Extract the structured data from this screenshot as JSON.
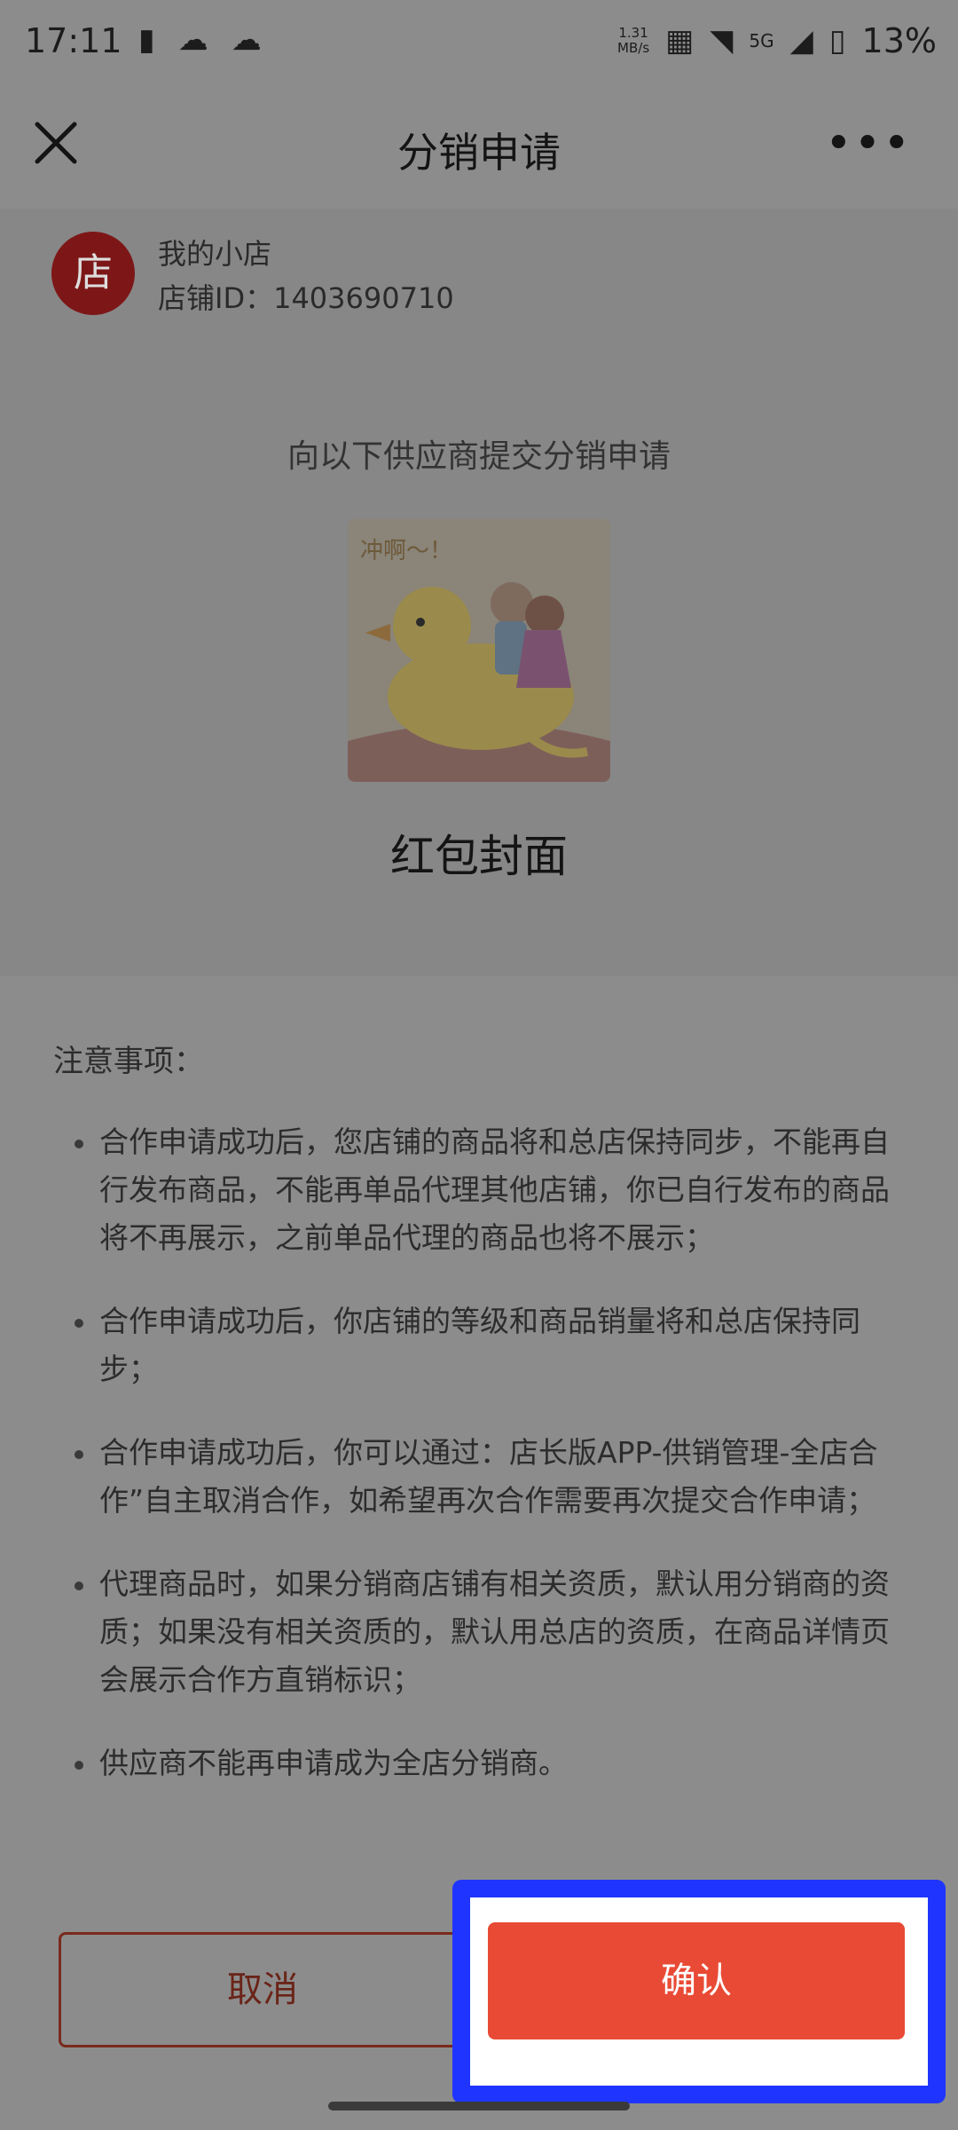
{
  "status_bar": {
    "time": "17:11",
    "net_speed_value": "1.31",
    "net_speed_unit": "MB/s",
    "signal_label": "5G",
    "battery": "13%"
  },
  "nav": {
    "title": "分销申请"
  },
  "shop": {
    "avatar_char": "店",
    "name": "我的小店",
    "id": "店铺ID：1403690710"
  },
  "supplier": {
    "caption": "向以下供应商提交分销申请",
    "logo_caption": "冲啊～！",
    "name": "红包封面"
  },
  "notes": {
    "title": "注意事项：",
    "items": [
      "合作申请成功后，您店铺的商品将和总店保持同步，不能再自行发布商品，不能再单品代理其他店铺，你已自行发布的商品将不再展示，之前单品代理的商品也将不展示；",
      "合作申请成功后，你店铺的等级和商品销量将和总店保持同步；",
      "合作申请成功后，你可以通过：店长版APP-供销管理-全店合作”自主取消合作，如希望再次合作需要再次提交合作申请；",
      "代理商品时，如果分销商店铺有相关资质，默认用分销商的资质；如果没有相关资质的，默认用总店的资质，在商品详情页会展示合作方直销标识；",
      "供应商不能再申请成为全店分销商。"
    ]
  },
  "buttons": {
    "cancel": "取消",
    "confirm": "确认"
  },
  "colors": {
    "confirm": "#e94a35",
    "highlight": "#1f35ff",
    "avatar": "#7d1717"
  }
}
